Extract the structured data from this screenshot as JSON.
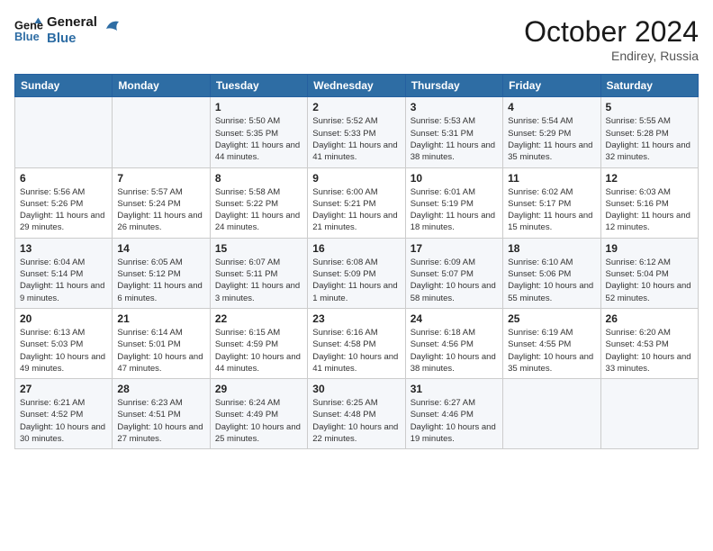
{
  "logo": {
    "line1": "General",
    "line2": "Blue"
  },
  "title": "October 2024",
  "location": "Endirey, Russia",
  "days_of_week": [
    "Sunday",
    "Monday",
    "Tuesday",
    "Wednesday",
    "Thursday",
    "Friday",
    "Saturday"
  ],
  "weeks": [
    [
      {
        "day": "",
        "info": ""
      },
      {
        "day": "",
        "info": ""
      },
      {
        "day": "1",
        "info": "Sunrise: 5:50 AM\nSunset: 5:35 PM\nDaylight: 11 hours and 44 minutes."
      },
      {
        "day": "2",
        "info": "Sunrise: 5:52 AM\nSunset: 5:33 PM\nDaylight: 11 hours and 41 minutes."
      },
      {
        "day": "3",
        "info": "Sunrise: 5:53 AM\nSunset: 5:31 PM\nDaylight: 11 hours and 38 minutes."
      },
      {
        "day": "4",
        "info": "Sunrise: 5:54 AM\nSunset: 5:29 PM\nDaylight: 11 hours and 35 minutes."
      },
      {
        "day": "5",
        "info": "Sunrise: 5:55 AM\nSunset: 5:28 PM\nDaylight: 11 hours and 32 minutes."
      }
    ],
    [
      {
        "day": "6",
        "info": "Sunrise: 5:56 AM\nSunset: 5:26 PM\nDaylight: 11 hours and 29 minutes."
      },
      {
        "day": "7",
        "info": "Sunrise: 5:57 AM\nSunset: 5:24 PM\nDaylight: 11 hours and 26 minutes."
      },
      {
        "day": "8",
        "info": "Sunrise: 5:58 AM\nSunset: 5:22 PM\nDaylight: 11 hours and 24 minutes."
      },
      {
        "day": "9",
        "info": "Sunrise: 6:00 AM\nSunset: 5:21 PM\nDaylight: 11 hours and 21 minutes."
      },
      {
        "day": "10",
        "info": "Sunrise: 6:01 AM\nSunset: 5:19 PM\nDaylight: 11 hours and 18 minutes."
      },
      {
        "day": "11",
        "info": "Sunrise: 6:02 AM\nSunset: 5:17 PM\nDaylight: 11 hours and 15 minutes."
      },
      {
        "day": "12",
        "info": "Sunrise: 6:03 AM\nSunset: 5:16 PM\nDaylight: 11 hours and 12 minutes."
      }
    ],
    [
      {
        "day": "13",
        "info": "Sunrise: 6:04 AM\nSunset: 5:14 PM\nDaylight: 11 hours and 9 minutes."
      },
      {
        "day": "14",
        "info": "Sunrise: 6:05 AM\nSunset: 5:12 PM\nDaylight: 11 hours and 6 minutes."
      },
      {
        "day": "15",
        "info": "Sunrise: 6:07 AM\nSunset: 5:11 PM\nDaylight: 11 hours and 3 minutes."
      },
      {
        "day": "16",
        "info": "Sunrise: 6:08 AM\nSunset: 5:09 PM\nDaylight: 11 hours and 1 minute."
      },
      {
        "day": "17",
        "info": "Sunrise: 6:09 AM\nSunset: 5:07 PM\nDaylight: 10 hours and 58 minutes."
      },
      {
        "day": "18",
        "info": "Sunrise: 6:10 AM\nSunset: 5:06 PM\nDaylight: 10 hours and 55 minutes."
      },
      {
        "day": "19",
        "info": "Sunrise: 6:12 AM\nSunset: 5:04 PM\nDaylight: 10 hours and 52 minutes."
      }
    ],
    [
      {
        "day": "20",
        "info": "Sunrise: 6:13 AM\nSunset: 5:03 PM\nDaylight: 10 hours and 49 minutes."
      },
      {
        "day": "21",
        "info": "Sunrise: 6:14 AM\nSunset: 5:01 PM\nDaylight: 10 hours and 47 minutes."
      },
      {
        "day": "22",
        "info": "Sunrise: 6:15 AM\nSunset: 4:59 PM\nDaylight: 10 hours and 44 minutes."
      },
      {
        "day": "23",
        "info": "Sunrise: 6:16 AM\nSunset: 4:58 PM\nDaylight: 10 hours and 41 minutes."
      },
      {
        "day": "24",
        "info": "Sunrise: 6:18 AM\nSunset: 4:56 PM\nDaylight: 10 hours and 38 minutes."
      },
      {
        "day": "25",
        "info": "Sunrise: 6:19 AM\nSunset: 4:55 PM\nDaylight: 10 hours and 35 minutes."
      },
      {
        "day": "26",
        "info": "Sunrise: 6:20 AM\nSunset: 4:53 PM\nDaylight: 10 hours and 33 minutes."
      }
    ],
    [
      {
        "day": "27",
        "info": "Sunrise: 6:21 AM\nSunset: 4:52 PM\nDaylight: 10 hours and 30 minutes."
      },
      {
        "day": "28",
        "info": "Sunrise: 6:23 AM\nSunset: 4:51 PM\nDaylight: 10 hours and 27 minutes."
      },
      {
        "day": "29",
        "info": "Sunrise: 6:24 AM\nSunset: 4:49 PM\nDaylight: 10 hours and 25 minutes."
      },
      {
        "day": "30",
        "info": "Sunrise: 6:25 AM\nSunset: 4:48 PM\nDaylight: 10 hours and 22 minutes."
      },
      {
        "day": "31",
        "info": "Sunrise: 6:27 AM\nSunset: 4:46 PM\nDaylight: 10 hours and 19 minutes."
      },
      {
        "day": "",
        "info": ""
      },
      {
        "day": "",
        "info": ""
      }
    ]
  ]
}
